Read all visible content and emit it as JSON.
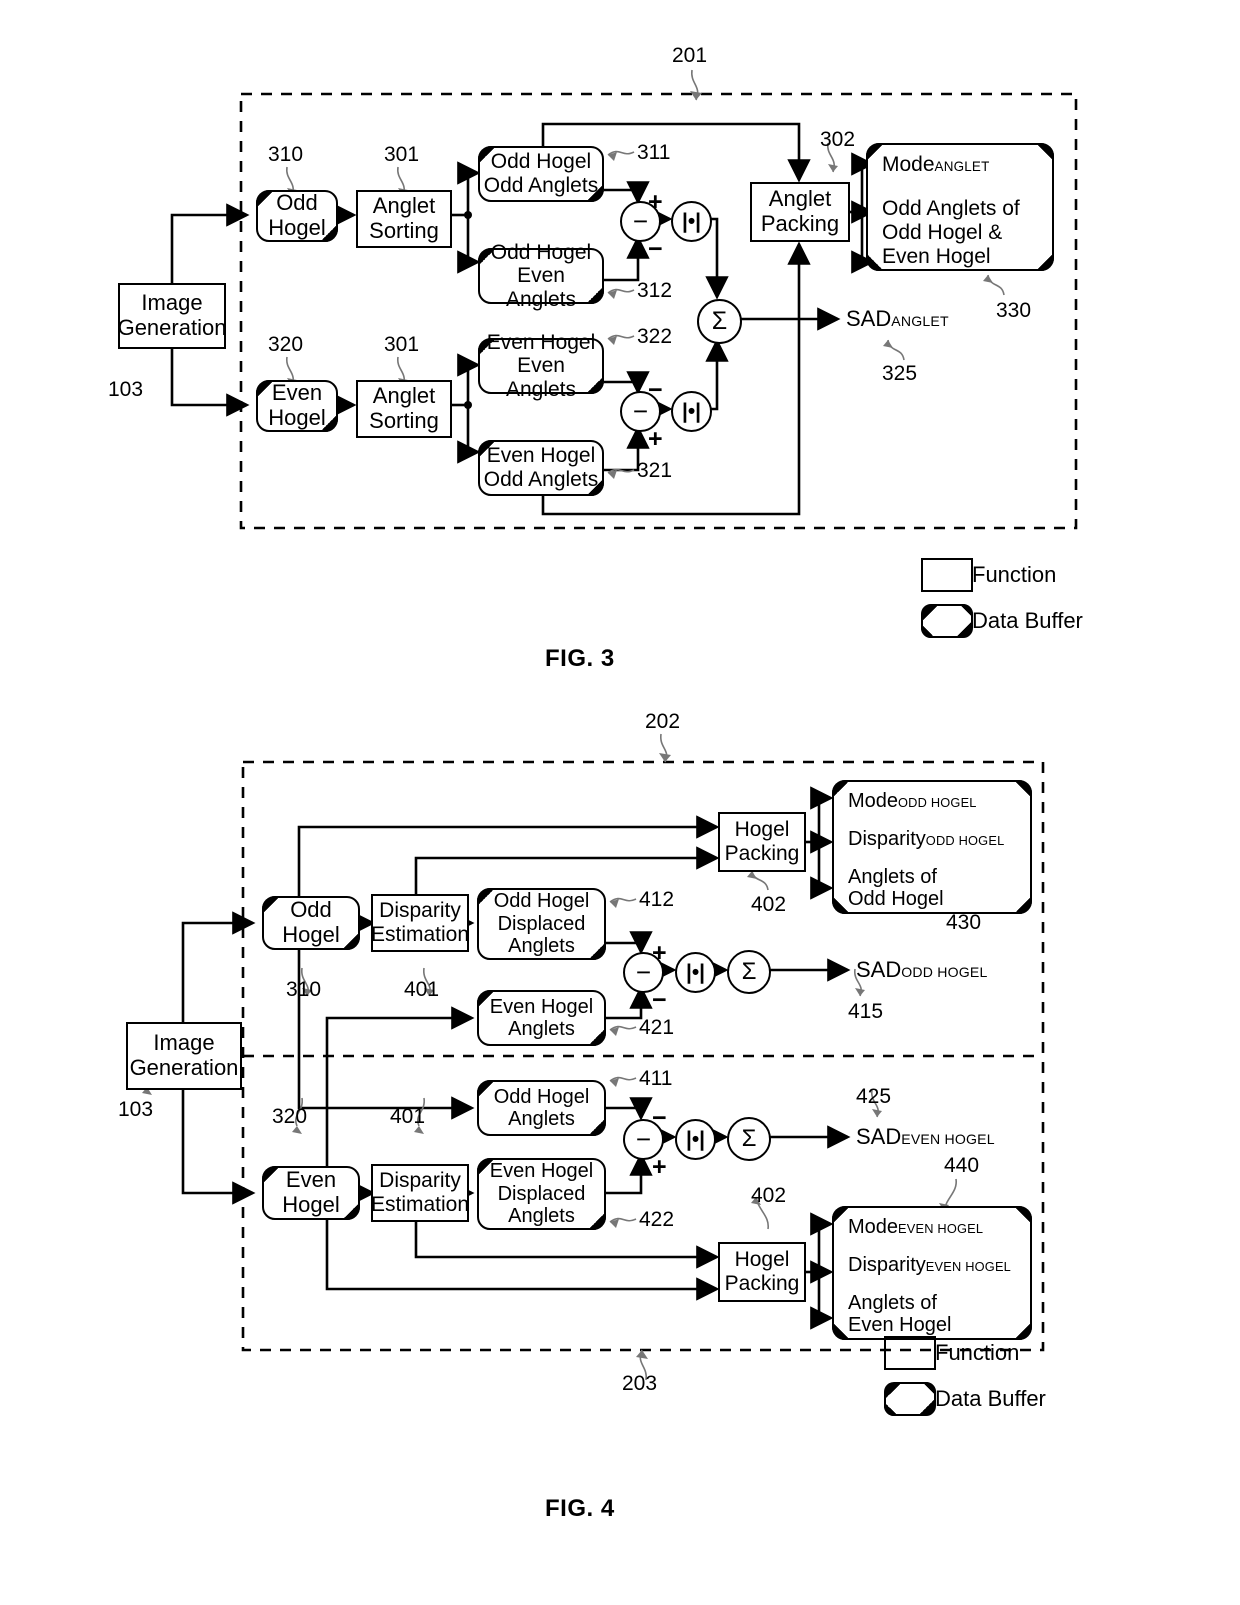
{
  "figures": [
    {
      "id": "fig3",
      "caption": "FIG. 3",
      "boundary_ref": "201",
      "source": {
        "label": "Image\nGeneration",
        "ref": "103"
      },
      "nodes": [
        {
          "name": "odd-hogel",
          "kind": "buffer",
          "label": "Odd\nHogel",
          "ref": "310"
        },
        {
          "name": "anglet-sorting-1",
          "kind": "function",
          "label": "Anglet\nSorting",
          "ref": "301"
        },
        {
          "name": "anglet-sorting-2",
          "kind": "function",
          "label": "Anglet\nSorting",
          "ref": "301"
        },
        {
          "name": "even-hogel",
          "kind": "buffer",
          "label": "Even\nHogel",
          "ref": "320"
        },
        {
          "name": "odd-hogel-odd-anglets",
          "kind": "buffer",
          "label": "Odd Hogel\nOdd Anglets",
          "ref": "311"
        },
        {
          "name": "odd-hogel-even-anglets",
          "kind": "buffer",
          "label": "Odd Hogel\nEven Anglets",
          "ref": "312"
        },
        {
          "name": "even-hogel-even-anglets",
          "kind": "buffer",
          "label": "Even Hogel\nEven Anglets",
          "ref": "322"
        },
        {
          "name": "even-hogel-odd-anglets",
          "kind": "buffer",
          "label": "Even Hogel\nOdd Anglets",
          "ref": "321"
        },
        {
          "name": "anglet-packing",
          "kind": "function",
          "label": "Anglet\nPacking",
          "ref": "302"
        }
      ],
      "output_buffer": {
        "ref": "330",
        "lines": [
          "Mode",
          "Odd Anglets of",
          "Odd Hogel &",
          "Even Hogel"
        ],
        "mode_subscript": "ANGLET"
      },
      "sad_output": {
        "text": "SAD",
        "subscript": "ANGLET",
        "ref": "325"
      },
      "operators": {
        "subtract": "−",
        "abs": "|•|",
        "sum": "Σ",
        "plus": "+",
        "minus": "−"
      },
      "legend": [
        {
          "shape": "function",
          "label": "Function"
        },
        {
          "shape": "buffer",
          "label": "Data Buffer"
        }
      ]
    },
    {
      "id": "fig4",
      "caption": "FIG. 4",
      "boundary_ref_top": "202",
      "boundary_ref_bottom": "203",
      "source": {
        "label": "Image\nGeneration",
        "ref": "103"
      },
      "nodes": [
        {
          "name": "odd-hogel",
          "kind": "buffer",
          "label": "Odd\nHogel",
          "ref": "310"
        },
        {
          "name": "disparity-estimation-1",
          "kind": "function",
          "label": "Disparity\nEstimation",
          "ref": "401"
        },
        {
          "name": "odd-hogel-displaced-anglets",
          "kind": "buffer",
          "label": "Odd Hogel\nDisplaced\nAnglets",
          "ref": "412"
        },
        {
          "name": "even-hogel-anglets",
          "kind": "buffer",
          "label": "Even Hogel\nAnglets",
          "ref": "421"
        },
        {
          "name": "hogel-packing-1",
          "kind": "function",
          "label": "Hogel\nPacking",
          "ref": "402"
        },
        {
          "name": "odd-hogel-anglets",
          "kind": "buffer",
          "label": "Odd Hogel\nAnglets",
          "ref": "411"
        },
        {
          "name": "even-hogel",
          "kind": "buffer",
          "label": "Even\nHogel",
          "ref": "320"
        },
        {
          "name": "disparity-estimation-2",
          "kind": "function",
          "label": "Disparity\nEstimation",
          "ref": "401"
        },
        {
          "name": "even-hogel-displaced-anglets",
          "kind": "buffer",
          "label": "Even Hogel\nDisplaced\nAnglets",
          "ref": "422"
        },
        {
          "name": "hogel-packing-2",
          "kind": "function",
          "label": "Hogel\nPacking",
          "ref": "402"
        }
      ],
      "output_buffer_odd": {
        "ref": "430",
        "lines": [
          "Mode",
          "Disparity",
          "Anglets of",
          "Odd Hogel"
        ],
        "subscript": "ODD HOGEL"
      },
      "output_buffer_even": {
        "ref": "440",
        "lines": [
          "Mode",
          "Disparity",
          "Anglets of",
          "Even Hogel"
        ],
        "subscript": "EVEN HOGEL"
      },
      "sad_odd": {
        "text": "SAD",
        "subscript": "ODD HOGEL",
        "ref": "415"
      },
      "sad_even": {
        "text": "SAD",
        "subscript": "EVEN HOGEL",
        "ref": "425"
      },
      "operators": {
        "subtract": "−",
        "abs": "|•|",
        "sum": "Σ",
        "plus": "+",
        "minus": "−"
      },
      "legend": [
        {
          "shape": "function",
          "label": "Function"
        },
        {
          "shape": "buffer",
          "label": "Data Buffer"
        }
      ]
    }
  ],
  "colors": {
    "ink": "#000000",
    "paper": "#ffffff",
    "leader": "#777777"
  }
}
